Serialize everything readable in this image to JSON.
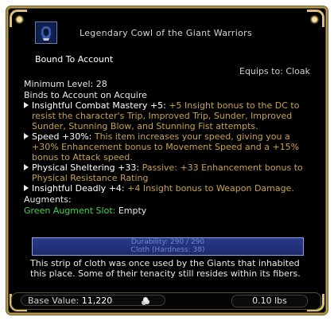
{
  "item": {
    "title": "Legendary Cowl of the Giant Warriors",
    "icon": "cowl-icon",
    "bound": "Bound To Account",
    "equips": "Equips to: Cloak",
    "min_level": "Minimum Level: 28",
    "binds": "Binds to Account on Acquire"
  },
  "effects": [
    {
      "name": "Insightful Combat Mastery +5:",
      "desc": "+5 Insight bonus to the DC to resist the character's Trip, Improved Trip, Sunder, Improved Sunder, Stunning Blow, and Stunning Fist attempts."
    },
    {
      "name": "Speed +30%:",
      "desc": "This item increases your speed, giving you a +30% Enhancement bonus to Movement Speed and a +15% bonus to Attack speed."
    },
    {
      "name": "Physical Sheltering +33:",
      "desc": "Passive: +33 Enhancement bonus to Physical Resistance Rating"
    },
    {
      "name": "Insightful Deadly +4:",
      "desc": "+4 Insight bonus to Weapon Damage."
    }
  ],
  "augments": {
    "label": "Augments:",
    "slot": "Green Augment Slot:",
    "value": "Empty"
  },
  "durability": {
    "line1": "Durability: 290 / 290",
    "line2": "Cloth (Hardness: 38)"
  },
  "lore": "This strip of cloth was once used by the Giants that inhabited this place. Some of their tenacity still resides within its fibers.",
  "footer": {
    "base_label": "Base Value:",
    "base_value": "11,220",
    "weight": "0.10 lbs"
  },
  "colors": {
    "frame": "#b89a52",
    "effect_desc": "#c9a24a",
    "augment_green": "#3dd44a",
    "durability_bar": "#2a3a8a"
  }
}
